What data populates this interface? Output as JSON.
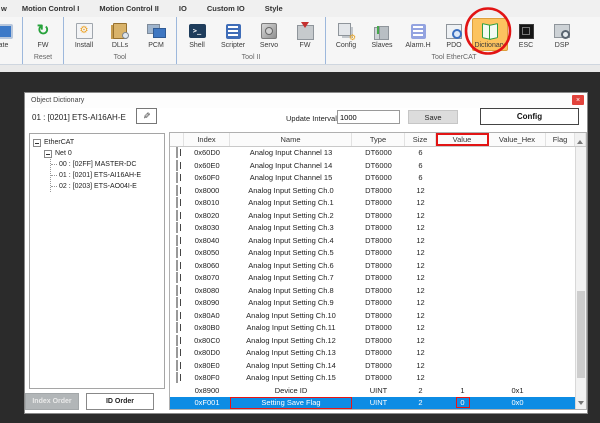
{
  "ribbon": {
    "tabs": [
      "w",
      "Motion Control I",
      "Motion Control II",
      "IO",
      "Custom IO",
      "Style"
    ],
    "groups": [
      {
        "label": "",
        "buttons": [
          {
            "label": "ate",
            "icon": "update-icon",
            "active": false
          }
        ]
      },
      {
        "label": "Reset",
        "buttons": [
          {
            "label": "FW",
            "icon": "firmware-reset-icon",
            "active": false
          }
        ]
      },
      {
        "label": "Tool",
        "buttons": [
          {
            "label": "Install",
            "icon": "install-icon",
            "active": false
          },
          {
            "label": "DLLs",
            "icon": "dlls-icon",
            "active": false
          },
          {
            "label": "PCM",
            "icon": "pcm-icon",
            "active": false
          }
        ]
      },
      {
        "label": "Tool II",
        "buttons": [
          {
            "label": "Shell",
            "icon": "shell-icon",
            "active": false
          },
          {
            "label": "Scripter",
            "icon": "scripter-icon",
            "active": false
          },
          {
            "label": "Servo",
            "icon": "servo-icon",
            "active": false
          },
          {
            "label": "FW",
            "icon": "firmware-icon",
            "active": false
          }
        ]
      },
      {
        "label": "Tool EtherCAT",
        "buttons": [
          {
            "label": "Config",
            "icon": "config-icon",
            "active": false
          },
          {
            "label": "Slaves",
            "icon": "slaves-icon",
            "active": false
          },
          {
            "label": "Alarm.H",
            "icon": "alarm-history-icon",
            "active": false
          },
          {
            "label": "PDO",
            "icon": "pdo-icon",
            "active": false
          },
          {
            "label": "Dictionary",
            "icon": "dictionary-icon",
            "active": true
          },
          {
            "label": "ESC",
            "icon": "esc-icon",
            "active": false
          },
          {
            "label": "DSP",
            "icon": "dsp-icon",
            "active": false
          }
        ]
      }
    ]
  },
  "dialog": {
    "title": "Object Dictionary",
    "device_label": "01 : [0201] ETS-AI16AH-E",
    "update_interval_label": "Update Interval",
    "update_interval_value": "1000",
    "save_label": "Save",
    "config_label": "Config",
    "index_order_label": "Index Order",
    "id_order_label": "ID Order",
    "tree": {
      "items": [
        {
          "label": "EtherCAT",
          "level": 0,
          "expander": true
        },
        {
          "label": "Net 0",
          "level": 1,
          "expander": true
        },
        {
          "label": "00 : [02FF] MASTER-DC",
          "level": 2,
          "expander": false
        },
        {
          "label": "01 : [0201] ETS-AI16AH-E",
          "level": 2,
          "expander": false
        },
        {
          "label": "02 : [0203] ETS-AO04I-E",
          "level": 2,
          "expander": false
        }
      ]
    },
    "table": {
      "columns": [
        "Index",
        "Name",
        "Type",
        "Size",
        "Value",
        "Value_Hex",
        "Flag"
      ],
      "annotated_column": "Value",
      "rows": [
        {
          "index": "0x60D0",
          "name": "Analog Input Channel 13",
          "type": "DT6000",
          "size": "6",
          "value": "",
          "value_hex": "",
          "flag": "",
          "expandable": true,
          "selected": false,
          "name_boxed": false,
          "value_boxed": false
        },
        {
          "index": "0x60E0",
          "name": "Analog Input Channel 14",
          "type": "DT6000",
          "size": "6",
          "value": "",
          "value_hex": "",
          "flag": "",
          "expandable": true,
          "selected": false,
          "name_boxed": false,
          "value_boxed": false
        },
        {
          "index": "0x60F0",
          "name": "Analog Input Channel 15",
          "type": "DT6000",
          "size": "6",
          "value": "",
          "value_hex": "",
          "flag": "",
          "expandable": true,
          "selected": false,
          "name_boxed": false,
          "value_boxed": false
        },
        {
          "index": "0x8000",
          "name": "Analog Input Setting Ch.0",
          "type": "DT8000",
          "size": "12",
          "value": "",
          "value_hex": "",
          "flag": "",
          "expandable": true,
          "selected": false,
          "name_boxed": false,
          "value_boxed": false
        },
        {
          "index": "0x8010",
          "name": "Analog Input Setting Ch.1",
          "type": "DT8000",
          "size": "12",
          "value": "",
          "value_hex": "",
          "flag": "",
          "expandable": true,
          "selected": false,
          "name_boxed": false,
          "value_boxed": false
        },
        {
          "index": "0x8020",
          "name": "Analog Input Setting Ch.2",
          "type": "DT8000",
          "size": "12",
          "value": "",
          "value_hex": "",
          "flag": "",
          "expandable": true,
          "selected": false,
          "name_boxed": false,
          "value_boxed": false
        },
        {
          "index": "0x8030",
          "name": "Analog Input Setting Ch.3",
          "type": "DT8000",
          "size": "12",
          "value": "",
          "value_hex": "",
          "flag": "",
          "expandable": true,
          "selected": false,
          "name_boxed": false,
          "value_boxed": false
        },
        {
          "index": "0x8040",
          "name": "Analog Input Setting Ch.4",
          "type": "DT8000",
          "size": "12",
          "value": "",
          "value_hex": "",
          "flag": "",
          "expandable": true,
          "selected": false,
          "name_boxed": false,
          "value_boxed": false
        },
        {
          "index": "0x8050",
          "name": "Analog Input Setting Ch.5",
          "type": "DT8000",
          "size": "12",
          "value": "",
          "value_hex": "",
          "flag": "",
          "expandable": true,
          "selected": false,
          "name_boxed": false,
          "value_boxed": false
        },
        {
          "index": "0x8060",
          "name": "Analog Input Setting Ch.6",
          "type": "DT8000",
          "size": "12",
          "value": "",
          "value_hex": "",
          "flag": "",
          "expandable": true,
          "selected": false,
          "name_boxed": false,
          "value_boxed": false
        },
        {
          "index": "0x8070",
          "name": "Analog Input Setting Ch.7",
          "type": "DT8000",
          "size": "12",
          "value": "",
          "value_hex": "",
          "flag": "",
          "expandable": true,
          "selected": false,
          "name_boxed": false,
          "value_boxed": false
        },
        {
          "index": "0x8080",
          "name": "Analog Input Setting Ch.8",
          "type": "DT8000",
          "size": "12",
          "value": "",
          "value_hex": "",
          "flag": "",
          "expandable": true,
          "selected": false,
          "name_boxed": false,
          "value_boxed": false
        },
        {
          "index": "0x8090",
          "name": "Analog Input Setting Ch.9",
          "type": "DT8000",
          "size": "12",
          "value": "",
          "value_hex": "",
          "flag": "",
          "expandable": true,
          "selected": false,
          "name_boxed": false,
          "value_boxed": false
        },
        {
          "index": "0x80A0",
          "name": "Analog Input Setting Ch.10",
          "type": "DT8000",
          "size": "12",
          "value": "",
          "value_hex": "",
          "flag": "",
          "expandable": true,
          "selected": false,
          "name_boxed": false,
          "value_boxed": false
        },
        {
          "index": "0x80B0",
          "name": "Analog Input Setting Ch.11",
          "type": "DT8000",
          "size": "12",
          "value": "",
          "value_hex": "",
          "flag": "",
          "expandable": true,
          "selected": false,
          "name_boxed": false,
          "value_boxed": false
        },
        {
          "index": "0x80C0",
          "name": "Analog Input Setting Ch.12",
          "type": "DT8000",
          "size": "12",
          "value": "",
          "value_hex": "",
          "flag": "",
          "expandable": true,
          "selected": false,
          "name_boxed": false,
          "value_boxed": false
        },
        {
          "index": "0x80D0",
          "name": "Analog Input Setting Ch.13",
          "type": "DT8000",
          "size": "12",
          "value": "",
          "value_hex": "",
          "flag": "",
          "expandable": true,
          "selected": false,
          "name_boxed": false,
          "value_boxed": false
        },
        {
          "index": "0x80E0",
          "name": "Analog Input Setting Ch.14",
          "type": "DT8000",
          "size": "12",
          "value": "",
          "value_hex": "",
          "flag": "",
          "expandable": true,
          "selected": false,
          "name_boxed": false,
          "value_boxed": false
        },
        {
          "index": "0x80F0",
          "name": "Analog Input Setting Ch.15",
          "type": "DT8000",
          "size": "12",
          "value": "",
          "value_hex": "",
          "flag": "",
          "expandable": true,
          "selected": false,
          "name_boxed": false,
          "value_boxed": false
        },
        {
          "index": "0x8900",
          "name": "Device ID",
          "type": "UINT",
          "size": "2",
          "value": "1",
          "value_hex": "0x1",
          "flag": "",
          "expandable": false,
          "selected": false,
          "name_boxed": false,
          "value_boxed": false
        },
        {
          "index": "0xF001",
          "name": "Setting Save Flag",
          "type": "UINT",
          "size": "2",
          "value": "0",
          "value_hex": "0x0",
          "flag": "",
          "expandable": false,
          "selected": true,
          "name_boxed": true,
          "value_boxed": true
        }
      ]
    }
  },
  "annotations": {
    "color": "#e21414",
    "circled_button": "Dictionary",
    "boxed_items": [
      "Value column header",
      "Setting Save Flag name cell",
      "Setting Save Flag value 0"
    ]
  },
  "colors": {
    "selection_blue": "#0d8ce4",
    "dictionary_highlight": "#fcc35f",
    "annotation_red": "#e21414",
    "desktop_background": "#2b2b2b",
    "close_button_red": "#e2433c"
  }
}
